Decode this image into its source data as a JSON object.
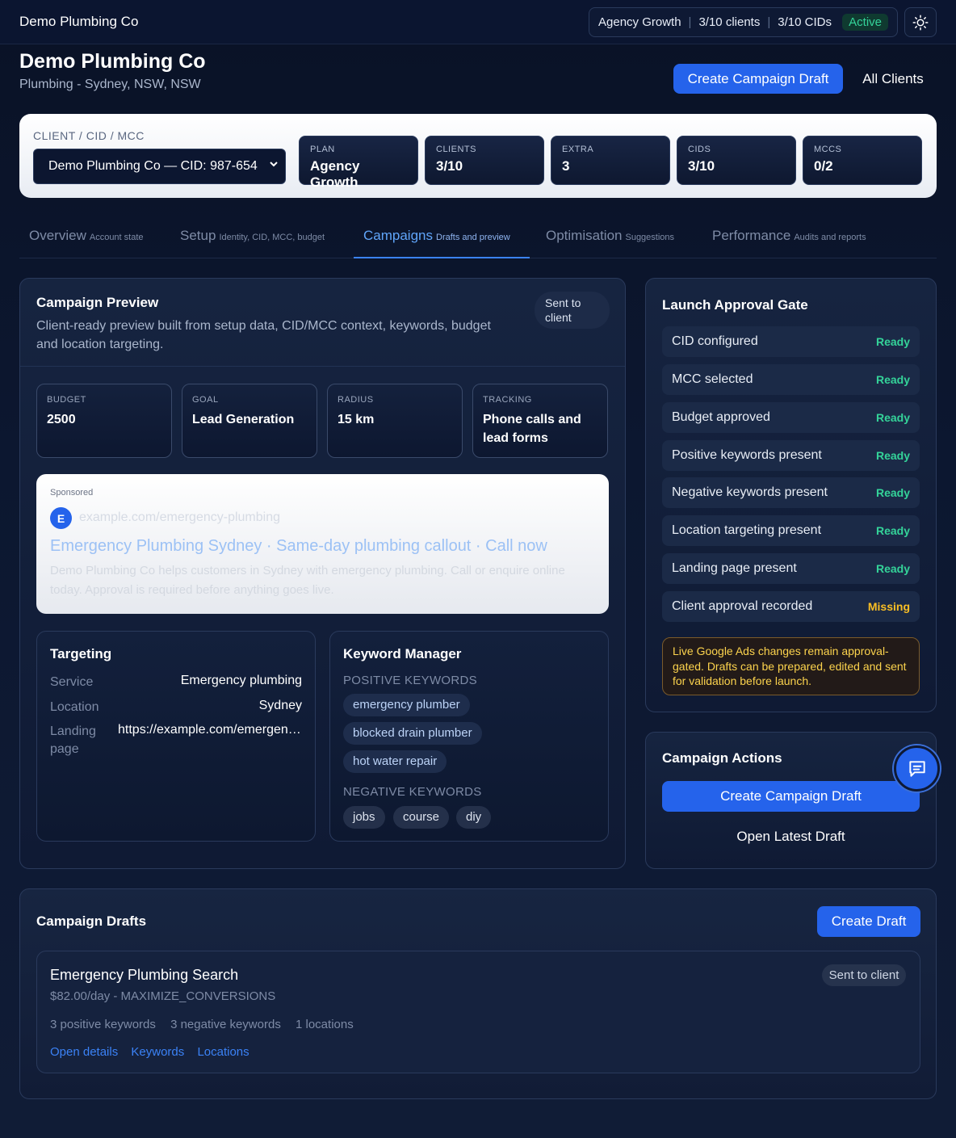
{
  "topbar": {
    "brand": "Demo Plumbing Co",
    "plan": "Agency Growth",
    "clients": "3/10 clients",
    "cids": "3/10 CIDs",
    "status": "Active"
  },
  "header": {
    "title": "Demo Plumbing Co",
    "subtitle": "Plumbing - Sydney, NSW, NSW",
    "create_label": "Create Campaign Draft",
    "all_clients_label": "All Clients"
  },
  "selector": {
    "label": "CLIENT / CID / MCC",
    "value": "Demo Plumbing Co — CID: 987-654",
    "stats": [
      {
        "key": "PLAN",
        "value": "Agency Growth"
      },
      {
        "key": "CLIENTS",
        "value": "3/10"
      },
      {
        "key": "EXTRA",
        "value": "3"
      },
      {
        "key": "CIDS",
        "value": "3/10"
      },
      {
        "key": "MCCS",
        "value": "0/2"
      }
    ]
  },
  "tabs": [
    {
      "label": "Overview",
      "sub": "Account state"
    },
    {
      "label": "Setup",
      "sub": "Identity, CID, MCC, budget"
    },
    {
      "label": "Campaigns",
      "sub": "Drafts and preview"
    },
    {
      "label": "Optimisation",
      "sub": "Suggestions"
    },
    {
      "label": "Performance",
      "sub": "Audits and reports"
    }
  ],
  "preview": {
    "title": "Campaign Preview",
    "description": "Client-ready preview built from setup data, CID/MCC context, keywords, budget and location targeting.",
    "status": "Sent to client",
    "metrics": [
      {
        "key": "BUDGET",
        "value": "2500"
      },
      {
        "key": "GOAL",
        "value": "Lead Generation"
      },
      {
        "key": "RADIUS",
        "value": "15 km"
      },
      {
        "key": "TRACKING",
        "value": "Phone calls and lead forms"
      }
    ],
    "ad": {
      "sponsored": "Sponsored",
      "avatar": "E",
      "url": "example.com/emergency-plumbing",
      "headline": "Emergency Plumbing Sydney · Same-day plumbing callout · Call now",
      "description": "Demo Plumbing Co helps customers in Sydney with emergency plumbing. Call or enquire online today. Approval is required before anything goes live."
    },
    "targeting": {
      "title": "Targeting",
      "rows": [
        {
          "label": "Service",
          "value": "Emergency plumbing"
        },
        {
          "label": "Location",
          "value": "Sydney"
        },
        {
          "label": "Landing page",
          "value": "https://example.com/emergency-plumbing"
        }
      ]
    },
    "keywords": {
      "title": "Keyword Manager",
      "positive_heading": "POSITIVE KEYWORDS",
      "positive": [
        "emergency plumber",
        "blocked drain plumber",
        "hot water repair"
      ],
      "negative_heading": "NEGATIVE KEYWORDS",
      "negative": [
        "jobs",
        "course",
        "diy"
      ]
    }
  },
  "gate": {
    "title": "Launch Approval Gate",
    "rows": [
      {
        "label": "CID configured",
        "status": "Ready"
      },
      {
        "label": "MCC selected",
        "status": "Ready"
      },
      {
        "label": "Budget approved",
        "status": "Ready"
      },
      {
        "label": "Positive keywords present",
        "status": "Ready"
      },
      {
        "label": "Negative keywords present",
        "status": "Ready"
      },
      {
        "label": "Location targeting present",
        "status": "Ready"
      },
      {
        "label": "Landing page present",
        "status": "Ready"
      },
      {
        "label": "Client approval recorded",
        "status": "Missing"
      }
    ],
    "note": "Live Google Ads changes remain approval-gated. Drafts can be prepared, edited and sent for validation before launch."
  },
  "actions": {
    "title": "Campaign Actions",
    "create_label": "Create Campaign Draft",
    "open_label": "Open Latest Draft"
  },
  "drafts": {
    "title": "Campaign Drafts",
    "create_label": "Create Draft",
    "items": [
      {
        "name": "Emergency Plumbing Search",
        "meta": "$82.00/day - MAXIMIZE_CONVERSIONS",
        "positive": "3 positive keywords",
        "negative": "3 negative keywords",
        "locations": "1 locations",
        "status": "Sent to client",
        "links": [
          "Open details",
          "Keywords",
          "Locations"
        ]
      }
    ]
  },
  "colors": {
    "accent": "#2563eb",
    "ready": "#34d399",
    "missing": "#fbbf24",
    "background": "#0c1730"
  },
  "icons": {
    "theme": "sun-icon",
    "chat": "chat-icon",
    "select": "chevron-down-icon"
  }
}
